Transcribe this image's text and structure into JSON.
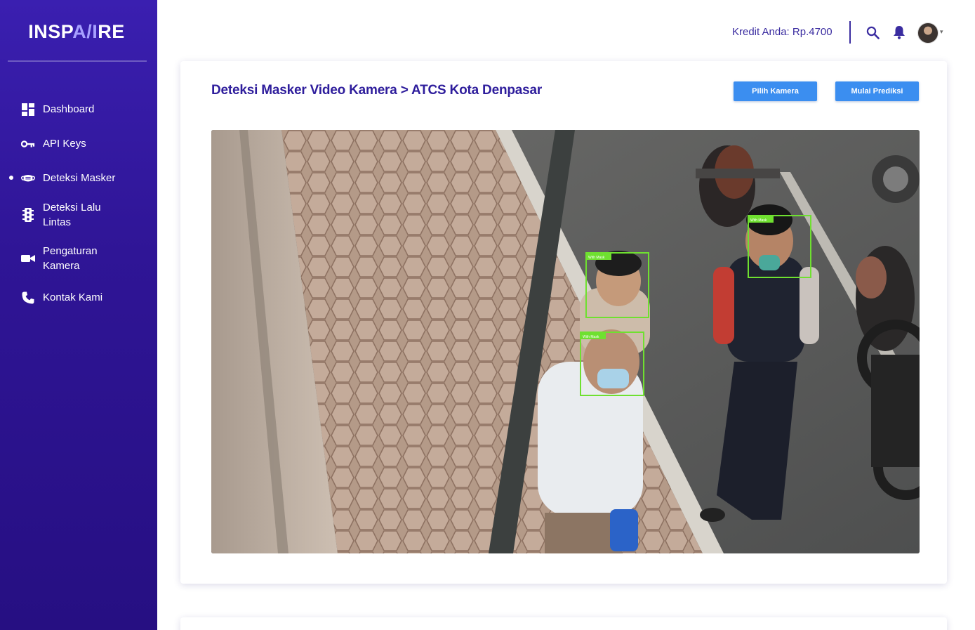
{
  "brand": {
    "logo_prefix": "INSP",
    "logo_ai": "A/I",
    "logo_suffix": "RE"
  },
  "sidebar": {
    "active_item": "Deteksi Masker",
    "items": [
      {
        "label": "Dashboard",
        "icon": "dashboard-icon"
      },
      {
        "label": "API Keys",
        "icon": "key-icon"
      },
      {
        "label": "Deteksi Masker",
        "icon": "mask-icon"
      },
      {
        "label": "Deteksi Lalu Lintas",
        "icon": "traffic-light-icon"
      },
      {
        "label": "Pengaturan Kamera",
        "icon": "video-camera-icon"
      },
      {
        "label": "Kontak Kami",
        "icon": "phone-icon"
      }
    ]
  },
  "header": {
    "credit_text": "Kredit Anda: Rp.4700",
    "icons": [
      "search-icon",
      "bell-icon",
      "avatar",
      "chevron-down-icon"
    ]
  },
  "main": {
    "title": "Deteksi Masker Video Kamera > ATCS Kota Denpasar",
    "buttons": {
      "choose_camera": "Pilih Kamera",
      "start_prediction": "Mulai Prediksi"
    },
    "video": {
      "description_icon": "camera-feed",
      "detections": [
        {
          "label": "With Mask",
          "status": "with-mask"
        },
        {
          "label": "With Mask",
          "status": "with-mask"
        },
        {
          "label": "With Mask",
          "status": "with-mask"
        }
      ]
    }
  },
  "colors": {
    "sidebar_top": "#3a1fb0",
    "sidebar_bottom": "#260f82",
    "title": "#2e1d9c",
    "button": "#3b8ef0",
    "detection_box": "#6fe030"
  }
}
